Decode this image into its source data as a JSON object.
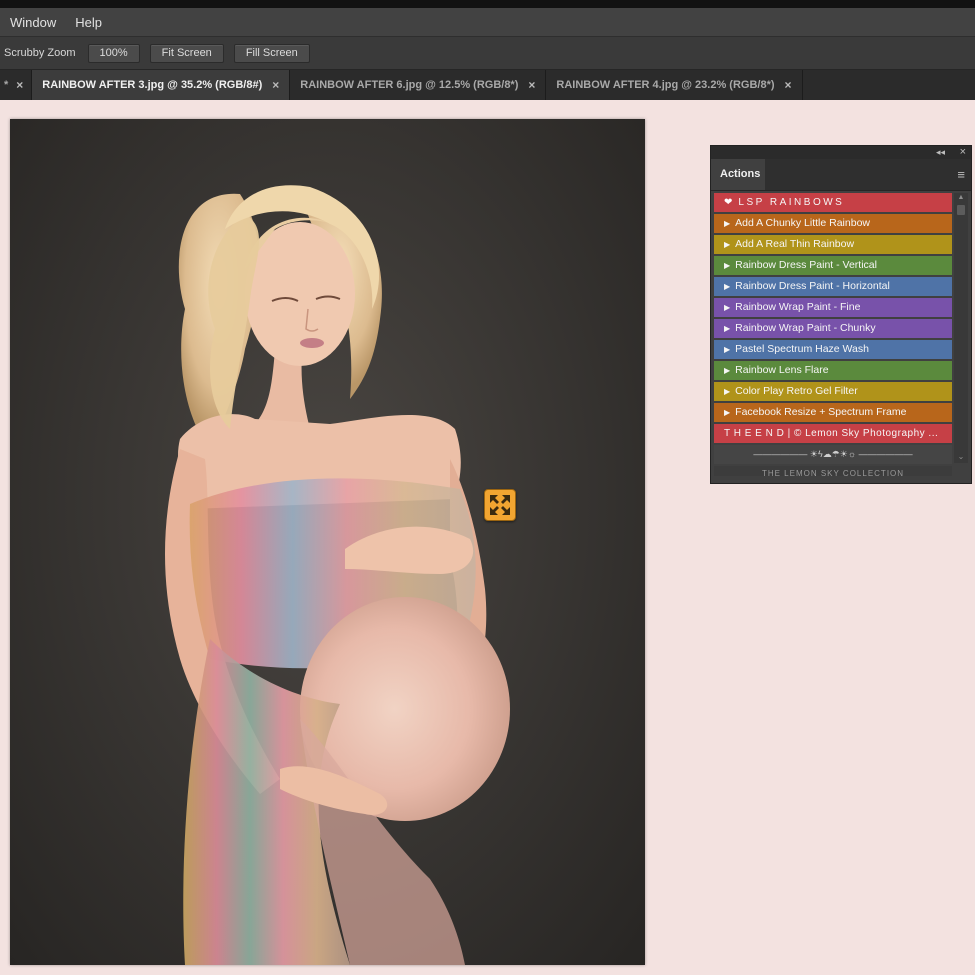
{
  "menu": {
    "items": [
      "Window",
      "Help"
    ]
  },
  "options": {
    "tool_label": "Scrubby Zoom",
    "zoom_value": "100%",
    "fit_screen": "Fit Screen",
    "fill_screen": "Fill Screen"
  },
  "tabs": [
    {
      "label": "*",
      "close": "×"
    },
    {
      "label": "RAINBOW AFTER 3.jpg @ 35.2% (RGB/8#)",
      "close": "×"
    },
    {
      "label": "RAINBOW AFTER 6.jpg @ 12.5% (RGB/8*)",
      "close": "×"
    },
    {
      "label": "RAINBOW AFTER 4.jpg @ 23.2% (RGB/8*)",
      "close": "×"
    }
  ],
  "actions_panel": {
    "title": "Actions",
    "collapse_glyph": "◂◂",
    "close_glyph": "×",
    "menu_glyph": "≡",
    "play_glyph": "▶",
    "header": {
      "heart": "❤",
      "label": "LSP RAINBOWS",
      "color": "#c64046"
    },
    "items": [
      {
        "label": "Add A Chunky Little Rainbow",
        "color": "#b8661b"
      },
      {
        "label": "Add A Real Thin Rainbow",
        "color": "#b0931a"
      },
      {
        "label": "Rainbow Dress Paint - Vertical",
        "color": "#5b8a3d"
      },
      {
        "label": "Rainbow Dress Paint - Horizontal",
        "color": "#4f73a7"
      },
      {
        "label": "Rainbow Wrap Paint - Fine",
        "color": "#7852aa"
      },
      {
        "label": "Rainbow Wrap Paint - Chunky",
        "color": "#7852aa"
      },
      {
        "label": "Pastel Spectrum Haze Wash",
        "color": "#4f73a7"
      },
      {
        "label": "Rainbow Lens Flare",
        "color": "#5b8a3d"
      },
      {
        "label": "Color Play Retro Gel Filter",
        "color": "#b0931a"
      },
      {
        "label": "Facebook Resize + Spectrum Frame",
        "color": "#b8661b"
      }
    ],
    "end": {
      "label": "T H E  E N D |  © Lemon Sky Photography ...",
      "color": "#c64046"
    },
    "divider": "——————    ☀ϟ☁☂☀☼    ——————",
    "footer": "THE LEMON SKY COLLECTION",
    "scroll_up": "▲",
    "scroll_down": "⌄"
  },
  "cursor": {
    "icon": "expand-arrows-icon"
  }
}
